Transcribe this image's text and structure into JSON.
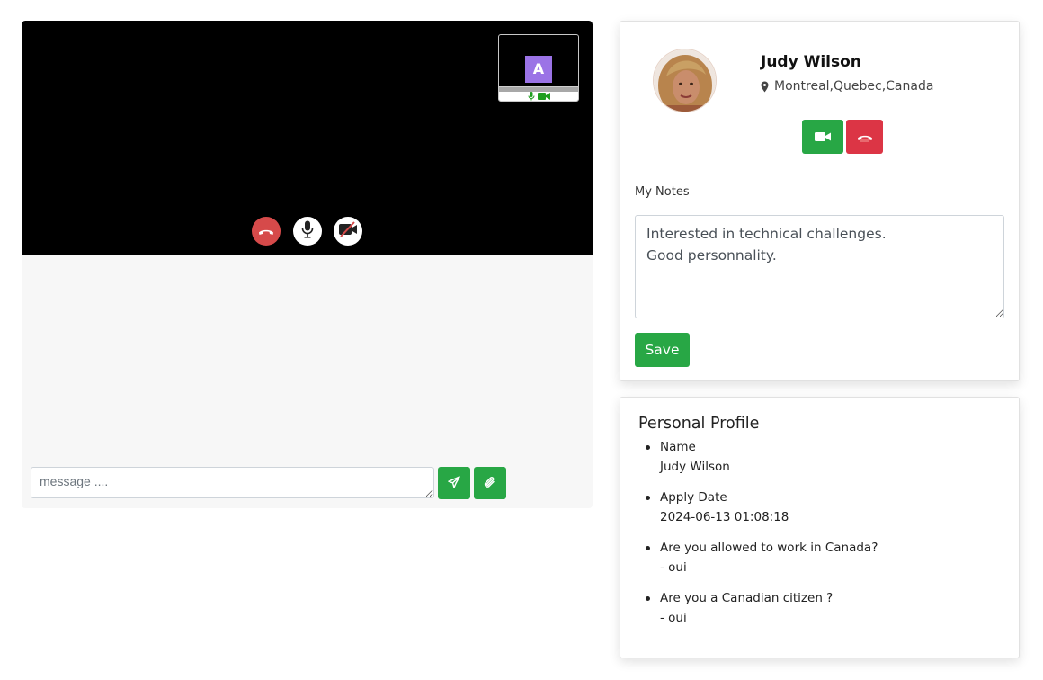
{
  "call": {
    "self_initial": "A",
    "colors": {
      "video_bg": "#000000",
      "hangup": "#d64a4a",
      "avatar_bg": "#9b73e6",
      "status_green": "#1e9e1e"
    },
    "controls": [
      {
        "name": "hangup",
        "icon": "phone-hangup-icon"
      },
      {
        "name": "mic",
        "icon": "microphone-icon"
      },
      {
        "name": "camera",
        "icon": "camera-off-icon"
      }
    ]
  },
  "chat": {
    "placeholder": "message ....",
    "send_icon": "send-icon",
    "attach_icon": "paperclip-icon"
  },
  "candidate": {
    "name": "Judy Wilson",
    "location": "Montreal,Quebec,Canada",
    "location_icon": "map-marker-icon",
    "video_button_icon": "video-camera-icon",
    "end_button_icon": "phone-hangup-icon"
  },
  "notes": {
    "label": "My Notes",
    "value": "Interested in technical challenges.\nGood personnality.",
    "save_label": "Save"
  },
  "personal_profile": {
    "title": "Personal Profile",
    "items": [
      {
        "question": "Name",
        "answer": "Judy Wilson"
      },
      {
        "question": "Apply Date",
        "answer": "2024-06-13 01:08:18"
      },
      {
        "question": "Are you allowed to work in Canada?",
        "answer": "- oui"
      },
      {
        "question": "Are you a Canadian citizen ?",
        "answer": "- oui"
      }
    ]
  },
  "theme": {
    "success": "#28a745",
    "danger": "#dc3545"
  }
}
